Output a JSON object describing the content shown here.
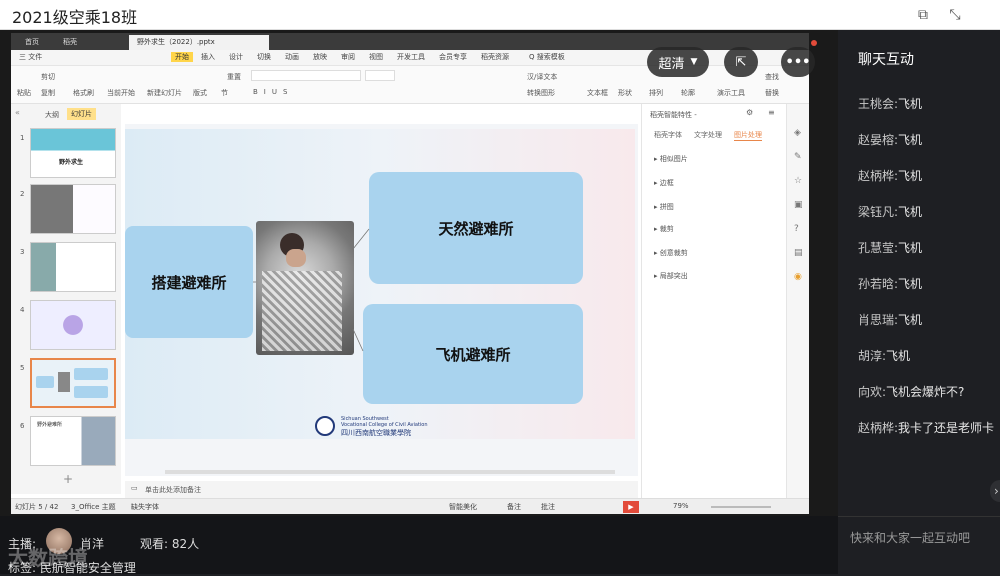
{
  "window": {
    "title": "2021级空乘18班"
  },
  "wps": {
    "tabs": [
      "首页",
      "稻壳",
      "野外求生（2022）.pptx"
    ],
    "menus": [
      "三 文件",
      "开始",
      "插入",
      "设计",
      "切换",
      "动画",
      "放映",
      "审阅",
      "视图",
      "开发工具",
      "会员专享",
      "稻壳资源",
      "Q 搜索模板"
    ],
    "ribbon": {
      "cut": "剪切",
      "paste": "粘贴",
      "copy": "复制",
      "format_painter": "格式刷",
      "play_from_current": "当前开始",
      "new_slide": "新建幻灯片",
      "layout": "版式",
      "section": "节",
      "reset": "重置",
      "textbox": "文本框",
      "shape": "形状",
      "arrange": "排列",
      "outline": "轮廓",
      "present_tool": "演示工具",
      "find": "查找",
      "replace": "替换",
      "select": "选择",
      "zh_en": "汉/译文本",
      "text_fill": "文本填充",
      "convert_shape": "转换图形"
    },
    "panel_tabs": [
      "大纲",
      "幻灯片"
    ],
    "slide_thumbs": [
      {
        "num": "1",
        "text": "野外求生"
      },
      {
        "num": "2",
        "text": ""
      },
      {
        "num": "3",
        "text": ""
      },
      {
        "num": "4",
        "text": ""
      },
      {
        "num": "5",
        "text": ""
      },
      {
        "num": "6",
        "text": "野外避难所"
      }
    ],
    "slide": {
      "box_left": "搭建避难所",
      "box_top": "天然避难所",
      "box_bottom": "飞机避难所",
      "logo_en_1": "Sichuan Southwest",
      "logo_en_2": "Vocational College of Civil Aviation",
      "logo_cn": "四川西南航空職業學院"
    },
    "notes_placeholder": "单击此处添加备注",
    "right_panel": {
      "title": "稻壳智能特性 -",
      "tabs": [
        "稻壳字体",
        "文字处理",
        "图片处理"
      ],
      "items": [
        "相似图片",
        "边框",
        "拼图",
        "裁剪",
        "创意裁剪",
        "局部突出"
      ]
    },
    "status": {
      "slide_count": "幻灯片 5 / 42",
      "theme": "3_Office 主题",
      "missing_font": "缺失字体",
      "smart_beautify": "智能美化",
      "notes": "备注",
      "comment": "批注",
      "zoom": "79%"
    }
  },
  "overlay": {
    "quality": "超清"
  },
  "chat": {
    "title": "聊天互动",
    "messages": [
      {
        "name": "王桃会:",
        "text": "飞机"
      },
      {
        "name": "赵晏榕:",
        "text": "飞机"
      },
      {
        "name": "赵柄桦:",
        "text": "飞机"
      },
      {
        "name": "梁钰凡:",
        "text": "飞机"
      },
      {
        "name": "孔慧莹:",
        "text": "飞机"
      },
      {
        "name": "孙若晗:",
        "text": "飞机"
      },
      {
        "name": "肖思瑞:",
        "text": "飞机"
      },
      {
        "name": "胡淳:",
        "text": "飞机"
      },
      {
        "name": "向欢:",
        "text": "飞机会爆炸不?"
      },
      {
        "name": "赵柄桦:",
        "text": "我卡了还是老师卡"
      }
    ],
    "input_placeholder": "快来和大家一起互动吧"
  },
  "footer": {
    "host_label": "主播:",
    "host_name": "肖洋",
    "viewers": "观看: 82人",
    "tag": "标签: 民航智能安全管理",
    "watermark": "大数跨境"
  }
}
